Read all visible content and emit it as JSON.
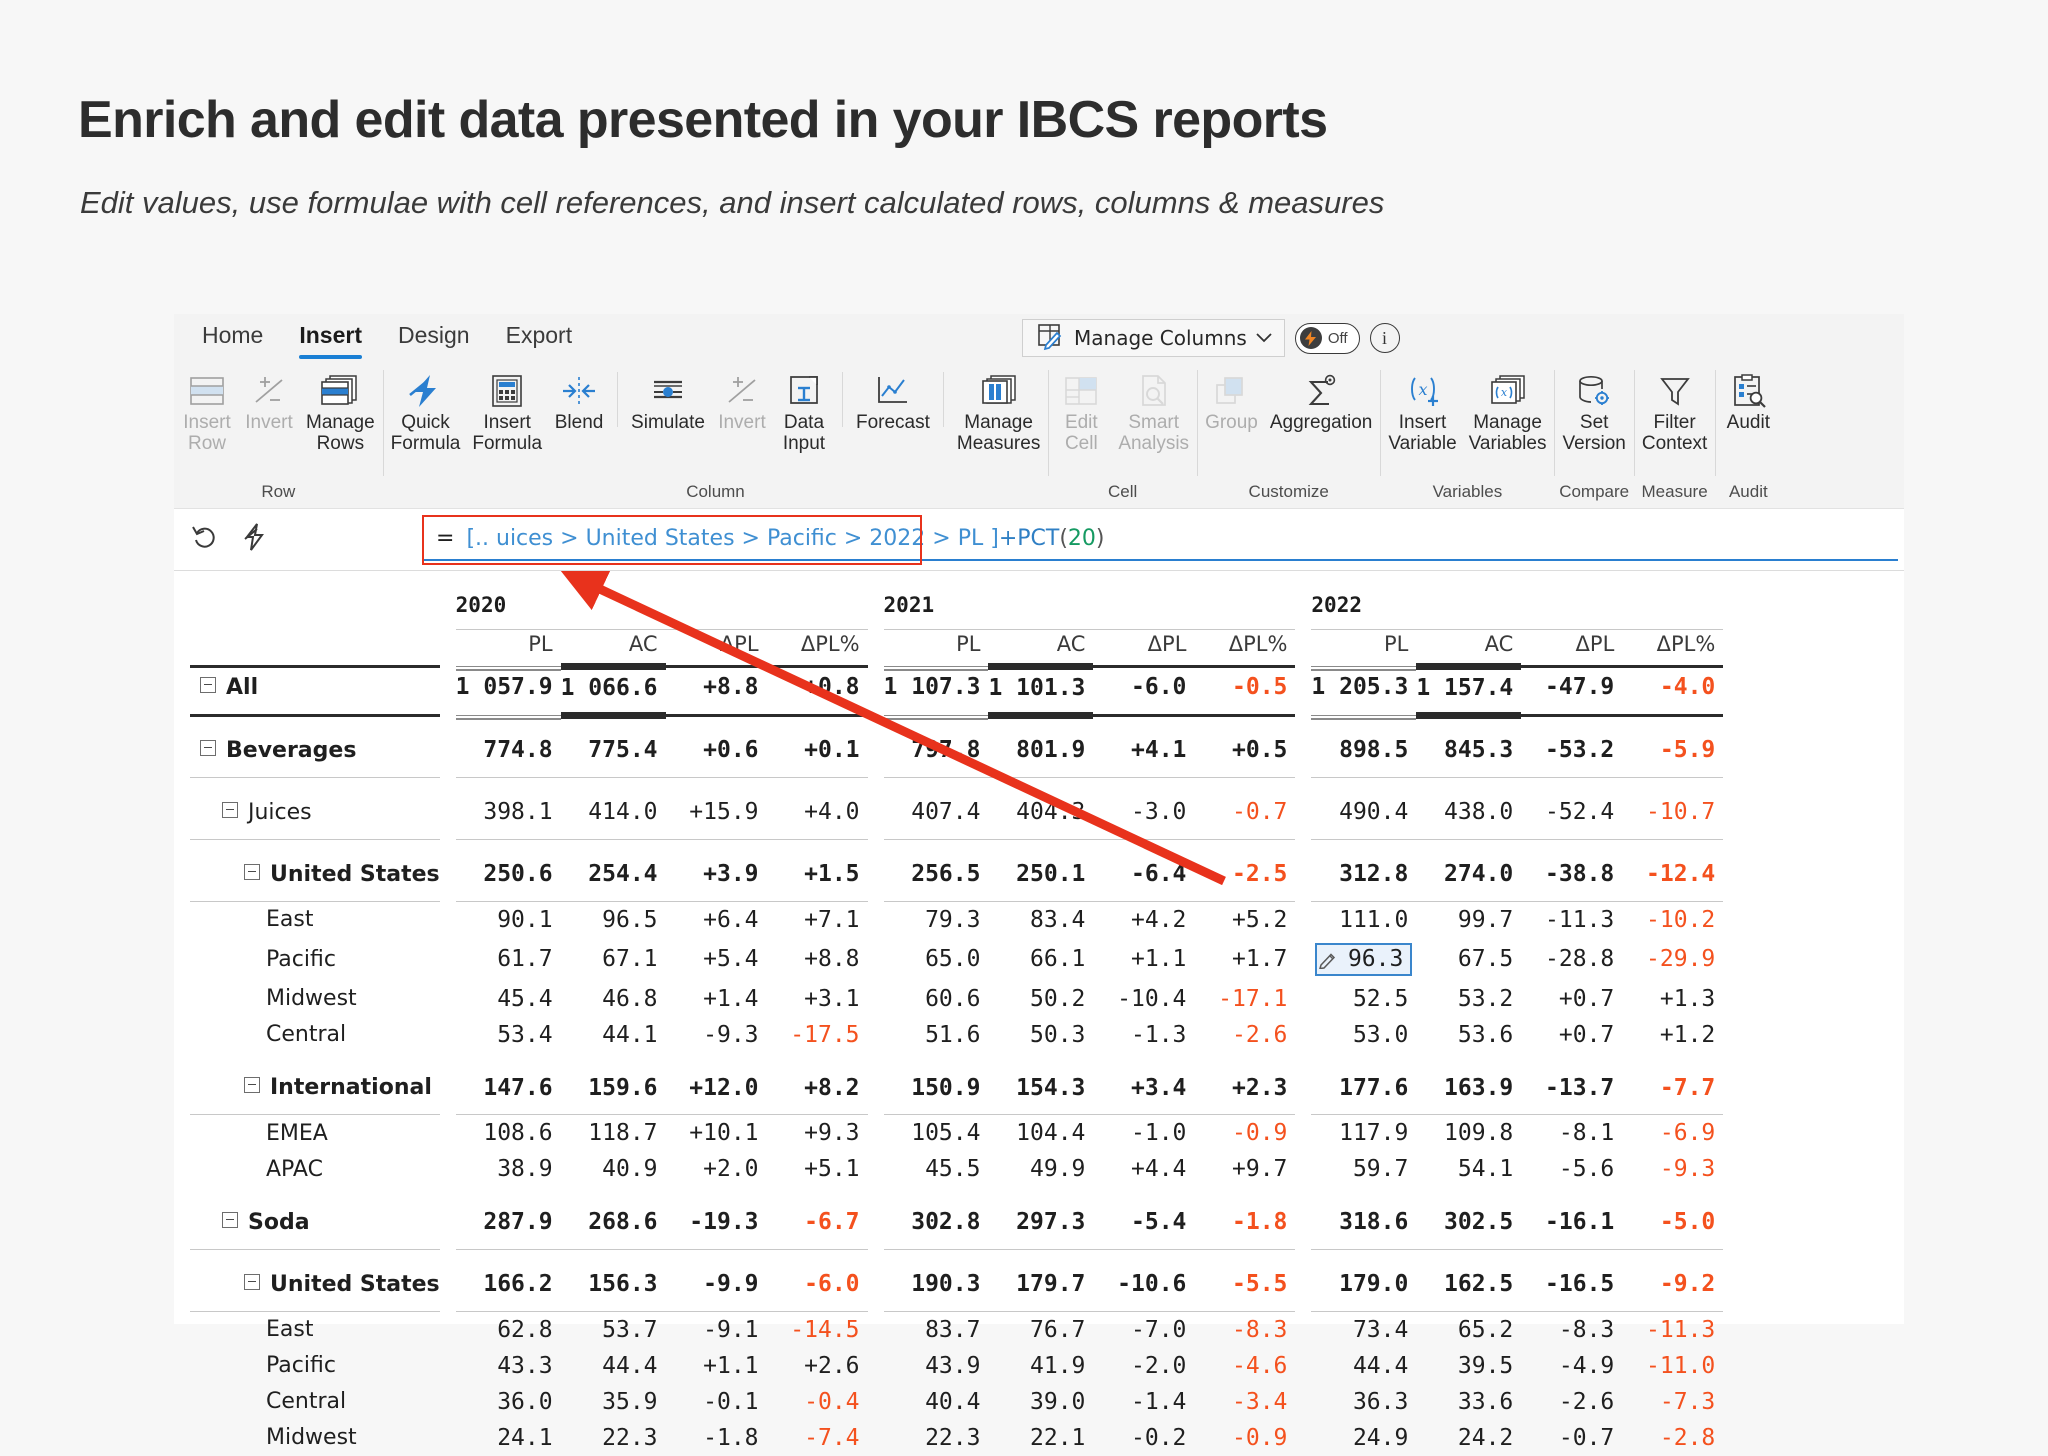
{
  "slide": {
    "title": "Enrich and edit data presented in your IBCS reports",
    "subtitle": "Edit values, use formulae with cell references, and insert calculated rows, columns & measures"
  },
  "ribbon": {
    "tabs": [
      {
        "label": "Home",
        "active": false
      },
      {
        "label": "Insert",
        "active": true
      },
      {
        "label": "Design",
        "active": false
      },
      {
        "label": "Export",
        "active": false
      }
    ],
    "manage_columns": {
      "label": "Manage Columns",
      "caret": "⌄",
      "icon": "manage-columns-icon",
      "toggle_label": "Off",
      "toggle_icon": "lightning-bolt-icon",
      "info_label": "i"
    },
    "groups": [
      {
        "label": "Row",
        "buttons": [
          {
            "t1": "Insert",
            "t2": "Row",
            "icon": "insert-row-icon",
            "disabled": true,
            "caret": true
          },
          {
            "t1": "Invert",
            "t2": "",
            "icon": "invert-row-icon",
            "disabled": true,
            "caret": false
          },
          {
            "t1": "Manage",
            "t2": "Rows",
            "icon": "manage-rows-icon",
            "disabled": false,
            "caret": false
          }
        ]
      },
      {
        "label": "Column",
        "buttons": [
          {
            "t1": "Quick",
            "t2": "Formula",
            "icon": "quick-formula-icon",
            "disabled": false,
            "caret": true
          },
          {
            "t1": "Insert",
            "t2": "Formula",
            "icon": "insert-formula-icon",
            "disabled": false,
            "caret": false
          },
          {
            "t1": "Blend",
            "t2": "",
            "icon": "blend-icon",
            "disabled": false,
            "caret": false
          },
          {
            "t1": "Simulate",
            "t2": "",
            "icon": "simulate-icon",
            "disabled": false,
            "caret": false,
            "divider": true
          },
          {
            "t1": "Invert",
            "t2": "",
            "icon": "invert-column-icon",
            "disabled": true,
            "caret": false
          },
          {
            "t1": "Data",
            "t2": "Input",
            "icon": "data-input-icon",
            "disabled": false,
            "caret": true
          },
          {
            "t1": "Forecast",
            "t2": "",
            "icon": "forecast-icon",
            "disabled": false,
            "caret": false,
            "divider": true
          },
          {
            "t1": "Manage",
            "t2": "Measures",
            "icon": "manage-measures-icon",
            "disabled": false,
            "caret": false,
            "divider": true
          }
        ]
      },
      {
        "label": "Cell",
        "buttons": [
          {
            "t1": "Edit",
            "t2": "Cell",
            "icon": "edit-cell-icon",
            "disabled": true,
            "caret": false
          },
          {
            "t1": "Smart",
            "t2": "Analysis",
            "icon": "smart-analysis-icon",
            "disabled": true,
            "caret": true
          }
        ]
      },
      {
        "label": "Customize",
        "buttons": [
          {
            "t1": "Group",
            "t2": "",
            "icon": "group-icon",
            "disabled": true,
            "caret": false
          },
          {
            "t1": "Aggregation",
            "t2": "",
            "icon": "aggregation-icon",
            "disabled": false,
            "caret": false
          }
        ]
      },
      {
        "label": "Variables",
        "buttons": [
          {
            "t1": "Insert",
            "t2": "Variable",
            "icon": "insert-variable-icon",
            "disabled": false,
            "caret": true
          },
          {
            "t1": "Manage",
            "t2": "Variables",
            "icon": "manage-variables-icon",
            "disabled": false,
            "caret": false
          }
        ]
      },
      {
        "label": "Compare",
        "buttons": [
          {
            "t1": "Set",
            "t2": "Version",
            "icon": "set-version-icon",
            "disabled": false,
            "caret": false
          }
        ]
      },
      {
        "label": "Measure",
        "buttons": [
          {
            "t1": "Filter",
            "t2": "Context",
            "icon": "filter-context-icon",
            "disabled": false,
            "caret": false
          }
        ]
      },
      {
        "label": "Audit",
        "buttons": [
          {
            "t1": "Audit",
            "t2": "",
            "icon": "audit-icon",
            "disabled": false,
            "caret": false
          }
        ]
      }
    ]
  },
  "formula_bar": {
    "undo_icon": "undo-icon",
    "flash_icon": "lightning-formula-icon",
    "equals": "=",
    "reference": "[.. uices > United States > Pacific > 2022 > PL ]",
    "function": "+PCT",
    "open_paren": "(",
    "argument": "20",
    "close_paren": ")",
    "full_text": "= [.. uices > United States > Pacific > 2022 > PL ] +PCT(20)"
  },
  "table": {
    "year_groups": [
      "2020",
      "2021",
      "2022"
    ],
    "measure_headers": [
      "PL",
      "AC",
      "ΔPL",
      "ΔPL%"
    ],
    "edited_cell": {
      "row": "Pacific",
      "year": "2022",
      "measure": "PL",
      "value": "96.3",
      "icon": "pencil-icon"
    },
    "rows": [
      {
        "label": "All",
        "indent": 0,
        "expandable": true,
        "bold": true,
        "rule_above": "thick",
        "rule_below": "thick",
        "values": [
          "1 057.9",
          "1 066.6",
          "+8.8",
          "+0.8",
          "1 107.3",
          "1 101.3",
          "-6.0",
          "-0.5",
          "1 205.3",
          "1 157.4",
          "-47.9",
          "-4.0"
        ],
        "neg": [
          false,
          false,
          false,
          false,
          false,
          false,
          false,
          true,
          false,
          false,
          false,
          true
        ]
      },
      {
        "label": "Beverages",
        "indent": 0,
        "expandable": true,
        "bold": true,
        "rule_below": "thin",
        "spacer_above": true,
        "values": [
          "774.8",
          "775.4",
          "+0.6",
          "+0.1",
          "797.8",
          "801.9",
          "+4.1",
          "+0.5",
          "898.5",
          "845.3",
          "-53.2",
          "-5.9"
        ],
        "neg": [
          false,
          false,
          false,
          false,
          false,
          false,
          false,
          false,
          false,
          false,
          false,
          true
        ]
      },
      {
        "label": "Juices",
        "indent": 1,
        "expandable": true,
        "bold": false,
        "rule_below": "thin",
        "spacer_above": true,
        "values": [
          "398.1",
          "414.0",
          "+15.9",
          "+4.0",
          "407.4",
          "404.3",
          "-3.0",
          "-0.7",
          "490.4",
          "438.0",
          "-52.4",
          "-10.7"
        ],
        "neg": [
          false,
          false,
          false,
          false,
          false,
          false,
          false,
          true,
          false,
          false,
          false,
          true
        ]
      },
      {
        "label": "United States",
        "indent": 2,
        "expandable": true,
        "bold": true,
        "rule_below": "thin",
        "spacer_above": true,
        "values": [
          "250.6",
          "254.4",
          "+3.9",
          "+1.5",
          "256.5",
          "250.1",
          "-6.4",
          "-2.5",
          "312.8",
          "274.0",
          "-38.8",
          "-12.4"
        ],
        "neg": [
          false,
          false,
          false,
          false,
          false,
          false,
          false,
          true,
          false,
          false,
          false,
          true
        ]
      },
      {
        "label": "East",
        "indent": 3,
        "expandable": false,
        "bold": false,
        "values": [
          "90.1",
          "96.5",
          "+6.4",
          "+7.1",
          "79.3",
          "83.4",
          "+4.2",
          "+5.2",
          "111.0",
          "99.7",
          "-11.3",
          "-10.2"
        ],
        "neg": [
          false,
          false,
          false,
          false,
          false,
          false,
          false,
          false,
          false,
          false,
          false,
          true
        ]
      },
      {
        "label": "Pacific",
        "indent": 3,
        "expandable": false,
        "bold": false,
        "edit_index": 8,
        "values": [
          "61.7",
          "67.1",
          "+5.4",
          "+8.8",
          "65.0",
          "66.1",
          "+1.1",
          "+1.7",
          "96.3",
          "67.5",
          "-28.8",
          "-29.9"
        ],
        "neg": [
          false,
          false,
          false,
          false,
          false,
          false,
          false,
          false,
          false,
          false,
          false,
          true
        ]
      },
      {
        "label": "Midwest",
        "indent": 3,
        "expandable": false,
        "bold": false,
        "values": [
          "45.4",
          "46.8",
          "+1.4",
          "+3.1",
          "60.6",
          "50.2",
          "-10.4",
          "-17.1",
          "52.5",
          "53.2",
          "+0.7",
          "+1.3"
        ],
        "neg": [
          false,
          false,
          false,
          false,
          false,
          false,
          false,
          true,
          false,
          false,
          false,
          false
        ]
      },
      {
        "label": "Central",
        "indent": 3,
        "expandable": false,
        "bold": false,
        "values": [
          "53.4",
          "44.1",
          "-9.3",
          "-17.5",
          "51.6",
          "50.3",
          "-1.3",
          "-2.6",
          "53.0",
          "53.6",
          "+0.7",
          "+1.2"
        ],
        "neg": [
          false,
          false,
          false,
          true,
          false,
          false,
          false,
          true,
          false,
          false,
          false,
          false
        ]
      },
      {
        "label": "International",
        "indent": 2,
        "expandable": true,
        "bold": true,
        "rule_below": "thin",
        "spacer_above": true,
        "values": [
          "147.6",
          "159.6",
          "+12.0",
          "+8.2",
          "150.9",
          "154.3",
          "+3.4",
          "+2.3",
          "177.6",
          "163.9",
          "-13.7",
          "-7.7"
        ],
        "neg": [
          false,
          false,
          false,
          false,
          false,
          false,
          false,
          false,
          false,
          false,
          false,
          true
        ]
      },
      {
        "label": "EMEA",
        "indent": 3,
        "expandable": false,
        "bold": false,
        "values": [
          "108.6",
          "118.7",
          "+10.1",
          "+9.3",
          "105.4",
          "104.4",
          "-1.0",
          "-0.9",
          "117.9",
          "109.8",
          "-8.1",
          "-6.9"
        ],
        "neg": [
          false,
          false,
          false,
          false,
          false,
          false,
          false,
          true,
          false,
          false,
          false,
          true
        ]
      },
      {
        "label": "APAC",
        "indent": 3,
        "expandable": false,
        "bold": false,
        "values": [
          "38.9",
          "40.9",
          "+2.0",
          "+5.1",
          "45.5",
          "49.9",
          "+4.4",
          "+9.7",
          "59.7",
          "54.1",
          "-5.6",
          "-9.3"
        ],
        "neg": [
          false,
          false,
          false,
          false,
          false,
          false,
          false,
          false,
          false,
          false,
          false,
          true
        ]
      },
      {
        "label": "Soda",
        "indent": 1,
        "expandable": true,
        "bold": true,
        "rule_below": "thin",
        "spacer_above": true,
        "values": [
          "287.9",
          "268.6",
          "-19.3",
          "-6.7",
          "302.8",
          "297.3",
          "-5.4",
          "-1.8",
          "318.6",
          "302.5",
          "-16.1",
          "-5.0"
        ],
        "neg": [
          false,
          false,
          false,
          true,
          false,
          false,
          false,
          true,
          false,
          false,
          false,
          true
        ]
      },
      {
        "label": "United States",
        "indent": 2,
        "expandable": true,
        "bold": true,
        "rule_below": "thin",
        "spacer_above": true,
        "values": [
          "166.2",
          "156.3",
          "-9.9",
          "-6.0",
          "190.3",
          "179.7",
          "-10.6",
          "-5.5",
          "179.0",
          "162.5",
          "-16.5",
          "-9.2"
        ],
        "neg": [
          false,
          false,
          false,
          true,
          false,
          false,
          false,
          true,
          false,
          false,
          false,
          true
        ]
      },
      {
        "label": "East",
        "indent": 3,
        "expandable": false,
        "bold": false,
        "values": [
          "62.8",
          "53.7",
          "-9.1",
          "-14.5",
          "83.7",
          "76.7",
          "-7.0",
          "-8.3",
          "73.4",
          "65.2",
          "-8.3",
          "-11.3"
        ],
        "neg": [
          false,
          false,
          false,
          true,
          false,
          false,
          false,
          true,
          false,
          false,
          false,
          true
        ]
      },
      {
        "label": "Pacific",
        "indent": 3,
        "expandable": false,
        "bold": false,
        "values": [
          "43.3",
          "44.4",
          "+1.1",
          "+2.6",
          "43.9",
          "41.9",
          "-2.0",
          "-4.6",
          "44.4",
          "39.5",
          "-4.9",
          "-11.0"
        ],
        "neg": [
          false,
          false,
          false,
          false,
          false,
          false,
          false,
          true,
          false,
          false,
          false,
          true
        ]
      },
      {
        "label": "Central",
        "indent": 3,
        "expandable": false,
        "bold": false,
        "values": [
          "36.0",
          "35.9",
          "-0.1",
          "-0.4",
          "40.4",
          "39.0",
          "-1.4",
          "-3.4",
          "36.3",
          "33.6",
          "-2.6",
          "-7.3"
        ],
        "neg": [
          false,
          false,
          false,
          true,
          false,
          false,
          false,
          true,
          false,
          false,
          false,
          true
        ]
      },
      {
        "label": "Midwest",
        "indent": 3,
        "expandable": false,
        "bold": false,
        "values": [
          "24.1",
          "22.3",
          "-1.8",
          "-7.4",
          "22.3",
          "22.1",
          "-0.2",
          "-0.9",
          "24.9",
          "24.2",
          "-0.7",
          "-2.8"
        ],
        "neg": [
          false,
          false,
          false,
          true,
          false,
          false,
          false,
          true,
          false,
          false,
          false,
          true
        ]
      }
    ]
  },
  "colors": {
    "accent": "#1a7fd4",
    "negative": "#f4511e",
    "annotation": "#e8321c",
    "edit_border": "#3a86cc"
  }
}
